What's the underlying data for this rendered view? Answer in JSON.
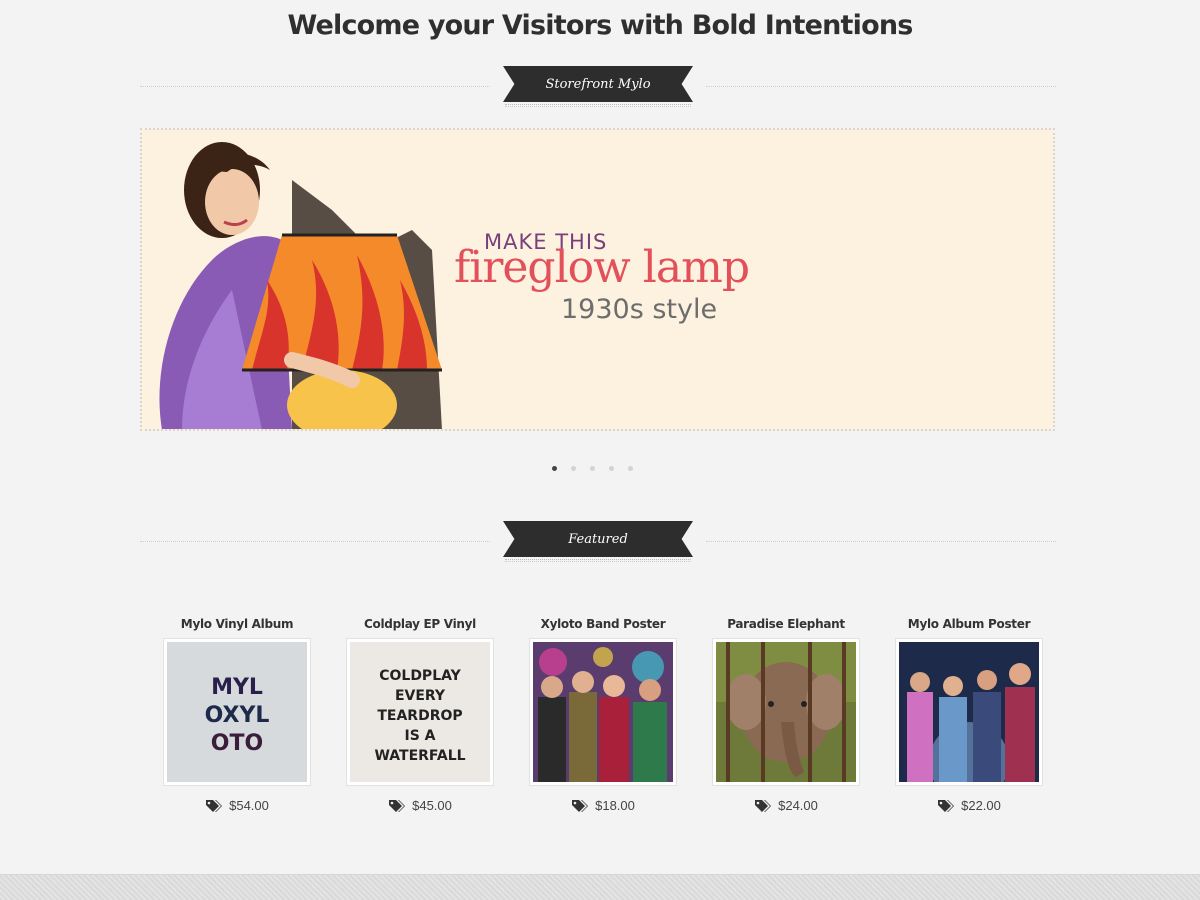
{
  "page": {
    "title": "Welcome your Visitors with Bold Intentions"
  },
  "store_ribbon": {
    "label": "Storefront Mylo"
  },
  "slider": {
    "headline_small": "MAKE THIS",
    "headline_big": "fireglow lamp",
    "headline_sub": "1930s style",
    "slide_count": 5,
    "active_slide": 1
  },
  "featured_ribbon": {
    "label": "Featured"
  },
  "products": [
    {
      "name": "Mylo Vinyl Album",
      "price": "$54.00",
      "art_text": [
        "MYL",
        "OXYL",
        "OTO"
      ]
    },
    {
      "name": "Coldplay EP Vinyl",
      "price": "$45.00",
      "art_text": [
        "COLDPLAY",
        "EVERY",
        "TEARDROP",
        "IS A",
        "WATERFALL"
      ]
    },
    {
      "name": "Xyloto Band Poster",
      "price": "$18.00"
    },
    {
      "name": "Paradise Elephant",
      "price": "$24.00"
    },
    {
      "name": "Mylo Album Poster",
      "price": "$22.00"
    }
  ],
  "icons": {
    "price": "price-tag-icon"
  },
  "colors": {
    "background": "#f3f3f3",
    "ribbon": "#2d2d2d",
    "slide_background": "#fdf2e0",
    "headline_accent": "#e2505a"
  }
}
